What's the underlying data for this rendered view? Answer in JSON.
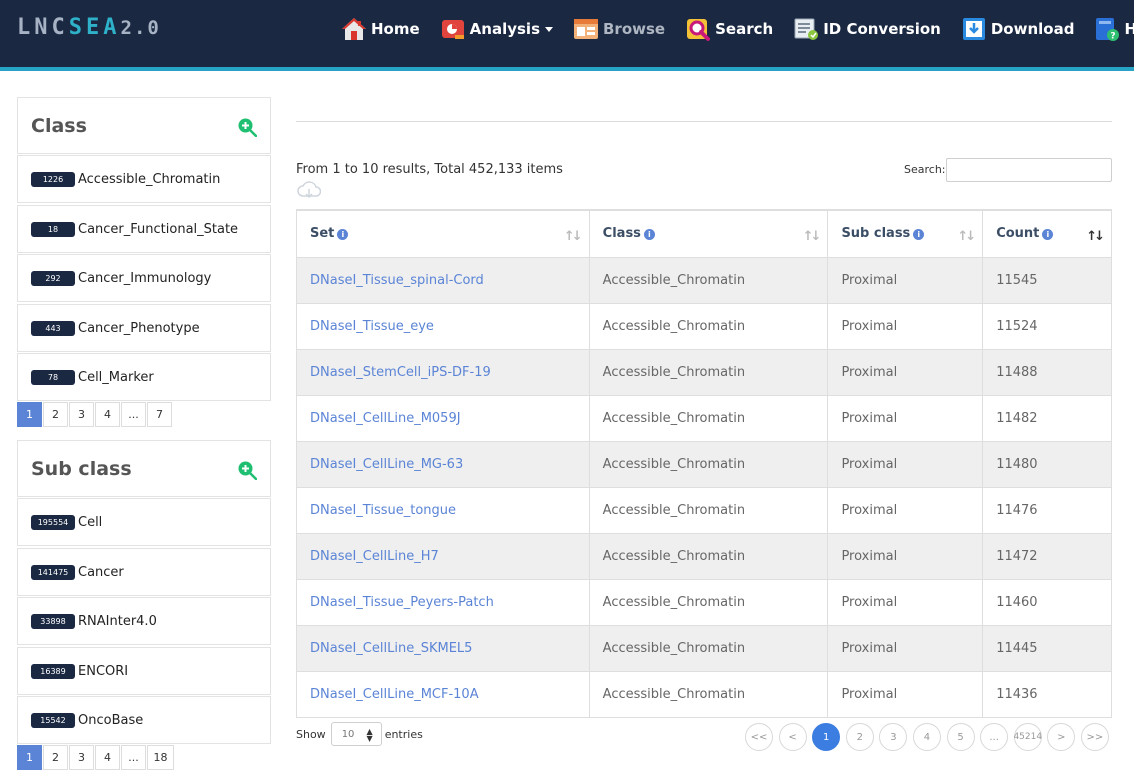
{
  "brand": {
    "part1": "LNC",
    "part2": "SEA",
    "version": "2.0"
  },
  "nav": [
    {
      "label": "Home",
      "icon": "home-icon"
    },
    {
      "label": "Analysis",
      "icon": "analysis-icon",
      "dropdown": true
    },
    {
      "label": "Browse",
      "icon": "browse-icon",
      "current": true
    },
    {
      "label": "Search",
      "icon": "search-icon"
    },
    {
      "label": "ID Conversion",
      "icon": "id-conversion-icon"
    },
    {
      "label": "Download",
      "icon": "download-icon"
    },
    {
      "label": "Help",
      "icon": "help-icon"
    }
  ],
  "class_panel": {
    "title": "Class",
    "items": [
      {
        "count": "1226",
        "label": "Accessible_Chromatin"
      },
      {
        "count": "18",
        "label": "Cancer_Functional_State"
      },
      {
        "count": "292",
        "label": "Cancer_Immunology"
      },
      {
        "count": "443",
        "label": "Cancer_Phenotype"
      },
      {
        "count": "78",
        "label": "Cell_Marker"
      }
    ],
    "pages": [
      "1",
      "2",
      "3",
      "4",
      "...",
      "7"
    ]
  },
  "subclass_panel": {
    "title": "Sub class",
    "items": [
      {
        "count": "195554",
        "label": "Cell"
      },
      {
        "count": "141475",
        "label": "Cancer"
      },
      {
        "count": "33898",
        "label": "RNAInter4.0"
      },
      {
        "count": "16389",
        "label": "ENCORI"
      },
      {
        "count": "15542",
        "label": "OncoBase"
      }
    ],
    "pages": [
      "1",
      "2",
      "3",
      "4",
      "...",
      "18"
    ]
  },
  "main": {
    "summary": "From 1 to 10 results, Total 452,133 items",
    "search_label": "Search:",
    "search_value": "",
    "columns": [
      {
        "label": "Set"
      },
      {
        "label": "Class"
      },
      {
        "label": "Sub class"
      },
      {
        "label": "Count",
        "sorted": true
      }
    ],
    "rows": [
      [
        "DNaseI_Tissue_spinal-Cord",
        "Accessible_Chromatin",
        "Proximal",
        "11545"
      ],
      [
        "DNaseI_Tissue_eye",
        "Accessible_Chromatin",
        "Proximal",
        "11524"
      ],
      [
        "DNaseI_StemCell_iPS-DF-19",
        "Accessible_Chromatin",
        "Proximal",
        "11488"
      ],
      [
        "DNaseI_CellLine_M059J",
        "Accessible_Chromatin",
        "Proximal",
        "11482"
      ],
      [
        "DNaseI_CellLine_MG-63",
        "Accessible_Chromatin",
        "Proximal",
        "11480"
      ],
      [
        "DNaseI_Tissue_tongue",
        "Accessible_Chromatin",
        "Proximal",
        "11476"
      ],
      [
        "DNaseI_CellLine_H7",
        "Accessible_Chromatin",
        "Proximal",
        "11472"
      ],
      [
        "DNaseI_Tissue_Peyers-Patch",
        "Accessible_Chromatin",
        "Proximal",
        "11460"
      ],
      [
        "DNaseI_CellLine_SKMEL5",
        "Accessible_Chromatin",
        "Proximal",
        "11445"
      ],
      [
        "DNaseI_CellLine_MCF-10A",
        "Accessible_Chromatin",
        "Proximal",
        "11436"
      ]
    ],
    "show_label": "Show",
    "entries_value": "10",
    "entries_label": "entries",
    "pages": [
      "<<",
      "<",
      "1",
      "2",
      "3",
      "4",
      "5",
      "...",
      "45214",
      ">",
      ">>"
    ],
    "active_page": "1"
  },
  "colors": {
    "navbar": "#1a2842",
    "accent": "#27a3c6",
    "link": "#5b84d6",
    "active_page": "#3b7de0"
  }
}
